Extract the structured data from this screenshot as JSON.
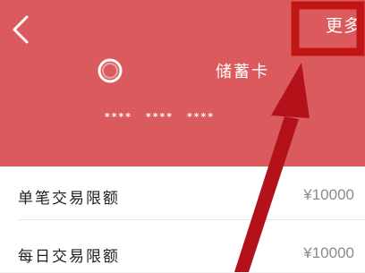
{
  "header": {
    "more_label": "更多",
    "back_icon": "chevron-left-icon",
    "card_logo_icon": "circle-logo-icon",
    "card_type": "储蓄卡",
    "masked_groups": [
      "****",
      "****",
      "****"
    ],
    "background_color": "#db5a5e"
  },
  "limits": [
    {
      "label": "单笔交易限额",
      "value": "¥10000"
    },
    {
      "label": "每日交易限额",
      "value": "¥10000"
    }
  ],
  "annotation": {
    "highlight_color": "#c21515",
    "arrow_color": "#b3121a"
  }
}
